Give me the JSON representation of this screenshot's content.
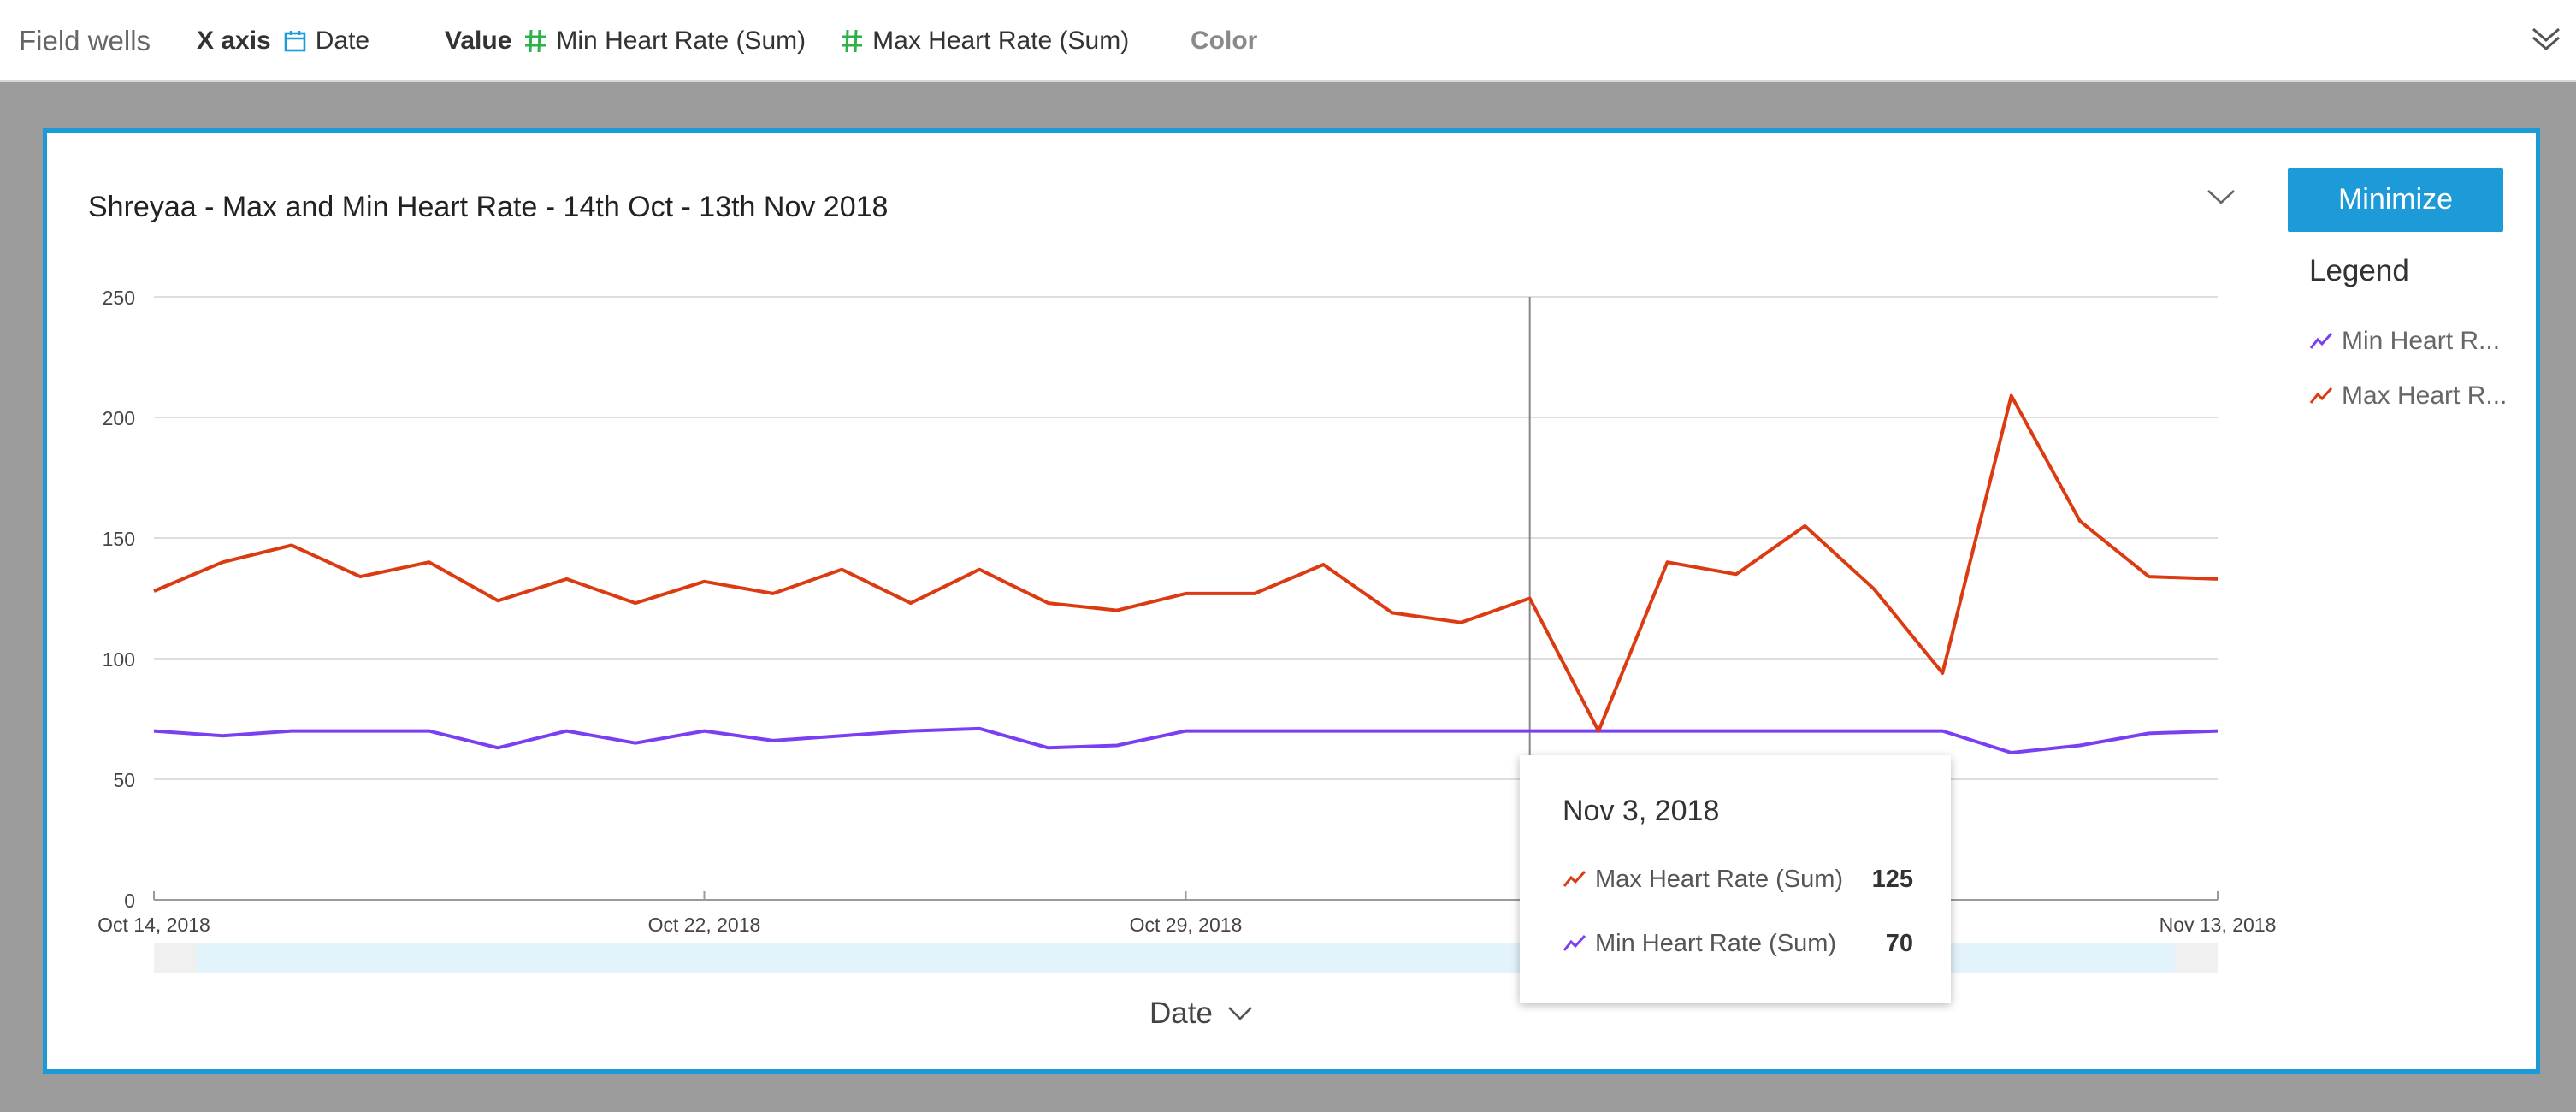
{
  "field_wells": {
    "title": "Field wells",
    "x_axis_label": "X axis",
    "x_axis_field": "Date",
    "value_label": "Value",
    "value_fields": [
      "Min Heart Rate (Sum)",
      "Max Heart Rate (Sum)"
    ],
    "color_label": "Color",
    "icons": {
      "x_axis": "calendar-icon",
      "value": "hash-icon",
      "expand": "double-chevron-down-icon"
    }
  },
  "visual": {
    "title": "Shreyaa - Max and Min Heart Rate - 14th Oct - 13th Nov 2018",
    "minimize_label": "Minimize",
    "legend_title": "Legend",
    "legend_items": [
      "Min Heart R...",
      "Max Heart R..."
    ],
    "x_axis_title": "Date"
  },
  "tooltip": {
    "date": "Nov 3, 2018",
    "rows": [
      {
        "label": "Max Heart Rate (Sum)",
        "value": "125"
      },
      {
        "label": "Min Heart Rate (Sum)",
        "value": "70"
      }
    ]
  },
  "colors": {
    "accent": "#1a9ad6",
    "min_series": "#7b3ff2",
    "max_series": "#dc3b12",
    "field_hash": "#2db24a"
  },
  "chart_data": {
    "type": "line",
    "title": "Shreyaa - Max and Min Heart Rate - 14th Oct - 13th Nov 2018",
    "xlabel": "Date",
    "ylabel": "",
    "ylim": [
      0,
      250
    ],
    "yticks": [
      0,
      50,
      100,
      150,
      200,
      250
    ],
    "x_tick_labels": [
      "Oct 14, 2018",
      "Oct 22, 2018",
      "Oct 29, 2018",
      "Nov 13, 2018"
    ],
    "x_tick_dates": [
      "2018-10-14",
      "2018-10-22",
      "2018-10-29",
      "2018-11-13"
    ],
    "x": [
      "2018-10-14",
      "2018-10-15",
      "2018-10-16",
      "2018-10-17",
      "2018-10-18",
      "2018-10-19",
      "2018-10-20",
      "2018-10-21",
      "2018-10-22",
      "2018-10-23",
      "2018-10-24",
      "2018-10-25",
      "2018-10-26",
      "2018-10-27",
      "2018-10-28",
      "2018-10-29",
      "2018-10-30",
      "2018-10-31",
      "2018-11-01",
      "2018-11-02",
      "2018-11-03",
      "2018-11-04",
      "2018-11-05",
      "2018-11-06",
      "2018-11-07",
      "2018-11-08",
      "2018-11-09",
      "2018-11-10",
      "2018-11-11",
      "2018-11-12",
      "2018-11-13"
    ],
    "series": [
      {
        "name": "Min Heart Rate (Sum)",
        "color": "#7b3ff2",
        "values": [
          70,
          68,
          70,
          70,
          70,
          63,
          70,
          65,
          70,
          66,
          68,
          70,
          71,
          63,
          64,
          70,
          70,
          70,
          70,
          70,
          70,
          70,
          70,
          70,
          70,
          70,
          70,
          61,
          64,
          69,
          70
        ]
      },
      {
        "name": "Max Heart Rate (Sum)",
        "color": "#dc3b12",
        "values": [
          128,
          140,
          147,
          134,
          140,
          124,
          133,
          123,
          132,
          127,
          137,
          123,
          137,
          123,
          120,
          127,
          127,
          139,
          119,
          115,
          125,
          70,
          140,
          135,
          155,
          129,
          94,
          209,
          157,
          134,
          133
        ]
      }
    ],
    "highlight": {
      "date": "2018-11-03"
    },
    "grid": true,
    "legend": "right"
  }
}
